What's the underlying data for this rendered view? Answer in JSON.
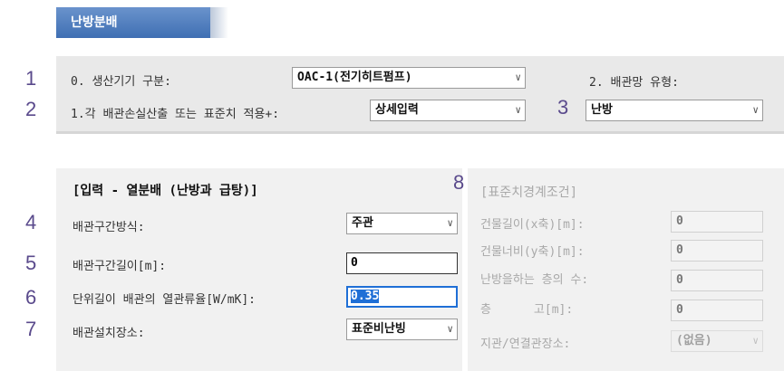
{
  "header": {
    "tab_title": "난방분배"
  },
  "markers": [
    "1",
    "2",
    "3",
    "4",
    "5",
    "6",
    "7",
    "8"
  ],
  "top_panel": {
    "producer_label": "0. 생산기기 구분:",
    "producer_value": "OAC-1(전기히트펌프)",
    "pipe_type_label": "2. 배관망 유형:",
    "calc_label": "1.각 배관손실산출 또는 표준치 적용+:",
    "calc_value": "상세입력",
    "pipe_type_value": "난방"
  },
  "input_panel": {
    "title": "[입력 - 열분배 (난방과 급탕)]",
    "section_method_label": "배관구간방식:",
    "section_method_value": "주관",
    "section_length_label": "배관구간길이[m]:",
    "section_length_value": "0",
    "heat_loss_label": "단위길이 배관의 열관류율[W/mK]:",
    "heat_loss_value": "0.35",
    "location_label": "배관설치장소:",
    "location_value": "표준비난빙"
  },
  "standard_panel": {
    "title": "[표준치경계조건]",
    "building_length_label": "건물길이(x축)[m]:",
    "building_length_value": "0",
    "building_width_label": "건물너비(y축)[m]:",
    "building_width_value": "0",
    "heated_floors_label": "난방을하는 층의 수:",
    "heated_floors_value": "0",
    "floor_height_label": "층      고[m]:",
    "floor_height_value": "0",
    "branch_location_label": "지관/연결관장소:",
    "branch_location_value": "(없음)"
  }
}
